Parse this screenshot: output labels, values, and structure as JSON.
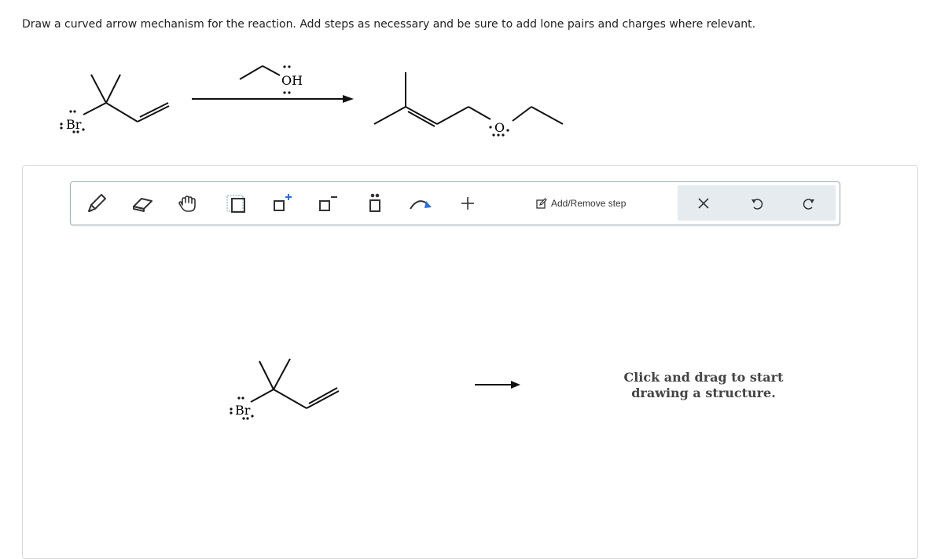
{
  "prompt": "Draw a curved arrow mechanism for the reaction. Add steps as necessary and be sure to add lone pairs and charges where relevant.",
  "reaction": {
    "reactant_label": "Br",
    "reagent_label": "OH",
    "product_label": "O"
  },
  "toolbar": {
    "tools": [
      {
        "name": "pencil-icon",
        "title": "Draw bond"
      },
      {
        "name": "eraser-icon",
        "title": "Erase"
      },
      {
        "name": "hand-icon",
        "title": "Move"
      },
      {
        "name": "select-box-icon",
        "title": "Select"
      },
      {
        "name": "positive-charge-icon",
        "title": "Positive charge"
      },
      {
        "name": "negative-charge-icon",
        "title": "Negative charge"
      },
      {
        "name": "lone-pair-icon",
        "title": "Lone pair"
      },
      {
        "name": "curved-arrow-icon",
        "title": "Curved arrow"
      },
      {
        "name": "plus-icon",
        "title": "Add"
      }
    ],
    "step_label": "Add/Remove step",
    "close_icon": "close-icon",
    "undo_icon": "undo-icon",
    "redo_icon": "redo-icon"
  },
  "workspace": {
    "reactant_label": "Br",
    "hint": "Click and drag to start drawing a structure."
  }
}
